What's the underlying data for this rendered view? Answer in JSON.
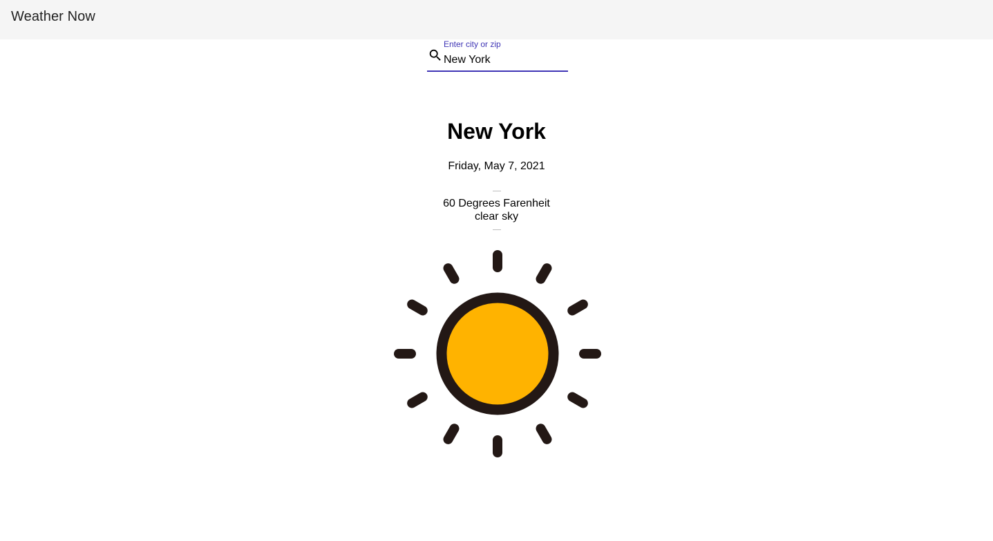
{
  "header": {
    "title": "Weather Now"
  },
  "search": {
    "label": "Enter city or zip",
    "value": "New York",
    "icon": "search-icon"
  },
  "weather": {
    "city": "New York",
    "date": "Friday, May 7, 2021",
    "temperature": "60 Degrees Farenheit",
    "description": "clear sky",
    "icon": "sun-icon"
  },
  "colors": {
    "accent": "#3f35b5",
    "header_bg": "#f5f5f5",
    "sun_fill": "#ffb300",
    "sun_outline": "#231815"
  }
}
